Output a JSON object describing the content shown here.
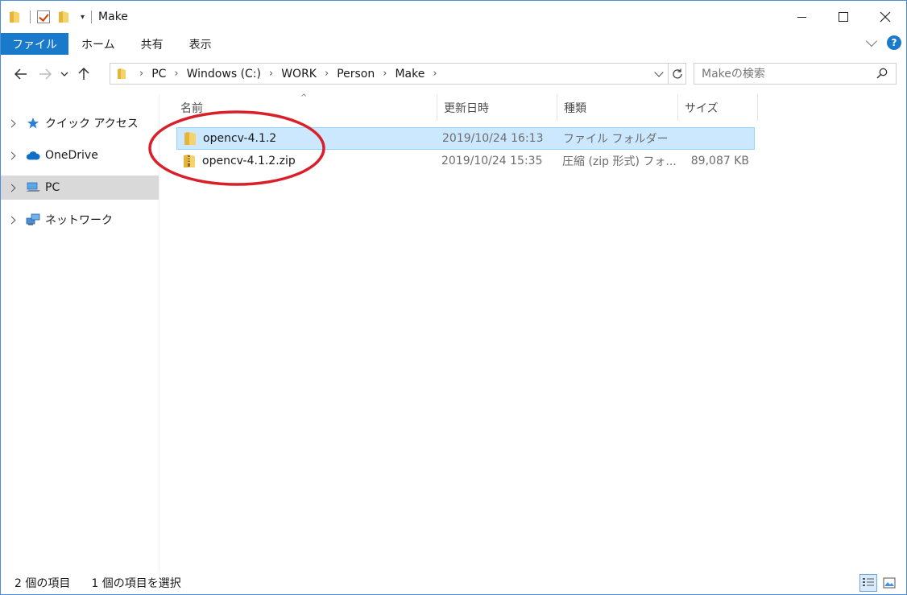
{
  "window": {
    "title": "Make"
  },
  "ribbon": {
    "tabs": [
      "ファイル",
      "ホーム",
      "共有",
      "表示"
    ],
    "active_tab": "ファイル",
    "help": "?"
  },
  "nav": {
    "breadcrumbs": [
      "PC",
      "Windows (C:)",
      "WORK",
      "Person",
      "Make"
    ],
    "search_placeholder": "Makeの検索"
  },
  "sidebar": {
    "items": [
      {
        "label": "クイック アクセス",
        "icon": "star-icon"
      },
      {
        "label": "OneDrive",
        "icon": "cloud-icon"
      },
      {
        "label": "PC",
        "icon": "pc-icon",
        "selected": true
      },
      {
        "label": "ネットワーク",
        "icon": "network-icon"
      }
    ]
  },
  "filelist": {
    "columns": [
      "名前",
      "更新日時",
      "種類",
      "サイズ"
    ],
    "rows": [
      {
        "name": "opencv-4.1.2",
        "date": "2019/10/24 16:13",
        "type": "ファイル フォルダー",
        "size": "",
        "icon": "folder-icon",
        "selected": true
      },
      {
        "name": "opencv-4.1.2.zip",
        "date": "2019/10/24 15:35",
        "type": "圧縮 (zip 形式) フォ...",
        "size": "89,087 KB",
        "icon": "zip-folder-icon",
        "selected": false
      }
    ]
  },
  "status": {
    "item_count": "2 個の項目",
    "selected_count": "1 個の項目を選択"
  },
  "colors": {
    "accent": "#1979ca",
    "selection": "#cce8ff",
    "annotation": "#d9202a",
    "folder": "#f2c94c"
  }
}
